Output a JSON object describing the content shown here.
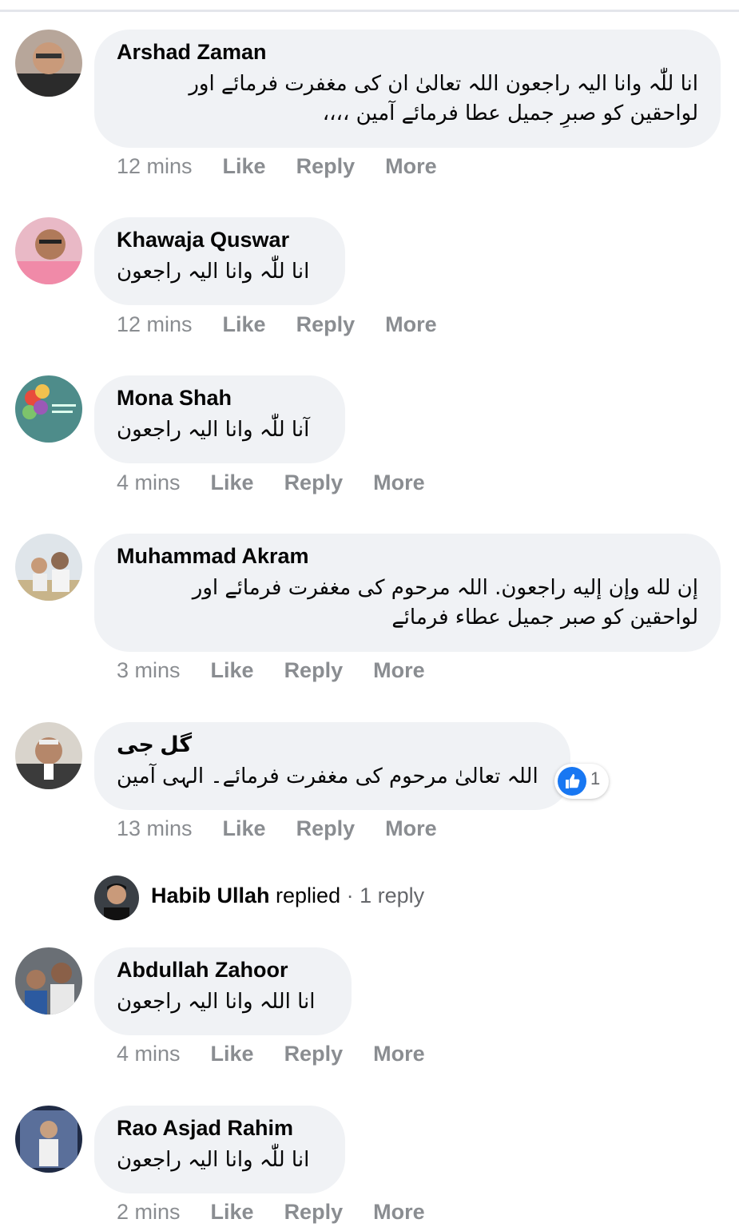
{
  "comments": [
    {
      "author": "Arshad Zaman",
      "lines": [
        "انا للّٰہ وانا الیہ راجعون اللہ تعالیٰ ان کی مغفرت فرمائے اور",
        "لواحقین کو صبرِ جمیل عطا فرمائے آمین ،،،،"
      ],
      "time": "12 mins",
      "like": "Like",
      "reply": "Reply",
      "more": "More",
      "avatar_icon": "profile-photo"
    },
    {
      "author": "Khawaja Quswar",
      "lines": [
        "انا للّٰہ وانا الیہ راجعون"
      ],
      "time": "12 mins",
      "like": "Like",
      "reply": "Reply",
      "more": "More",
      "avatar_icon": "profile-photo"
    },
    {
      "author": "Mona Shah",
      "lines": [
        "آنا للّٰہ وانا الیہ راجعون"
      ],
      "time": "4 mins",
      "like": "Like",
      "reply": "Reply",
      "more": "More",
      "avatar_icon": "balloons-photo"
    },
    {
      "author": "Muhammad Akram",
      "lines": [
        "إن لله وإن إليه راجعون. اللہ مرحوم کی مغفرت فرمائے اور",
        "لواحقین کو صبر جمیل عطاء فرمائے"
      ],
      "time": "3 mins",
      "like": "Like",
      "reply": "Reply",
      "more": "More",
      "avatar_icon": "profile-photo"
    },
    {
      "author": "گل جی",
      "lines": [
        "اللہ تعالیٰ مرحوم کی مغفرت فرمائے۔ الہی آمین"
      ],
      "time": "13 mins",
      "like": "Like",
      "reply": "Reply",
      "more": "More",
      "avatar_icon": "profile-photo",
      "reaction_count": "1",
      "reaction_icon": "thumbs-up-icon"
    },
    {
      "author": "Abdullah Zahoor",
      "lines": [
        "انا اللہ وانا الیہ راجعون"
      ],
      "time": "4 mins",
      "like": "Like",
      "reply": "Reply",
      "more": "More",
      "avatar_icon": "profile-photo"
    },
    {
      "author": "Rao Asjad Rahim",
      "lines": [
        "انا للّٰہ وانا الیہ راجعون"
      ],
      "time": "2 mins",
      "like": "Like",
      "reply": "Reply",
      "more": "More",
      "avatar_icon": "profile-photo"
    }
  ],
  "reply_summary": {
    "name": "Habib Ullah",
    "action": "replied",
    "separator": "·",
    "count": "1 reply"
  },
  "colors": {
    "bubble": "#f0f2f5",
    "muted": "#8a8d91",
    "like_blue": "#1877f2"
  }
}
